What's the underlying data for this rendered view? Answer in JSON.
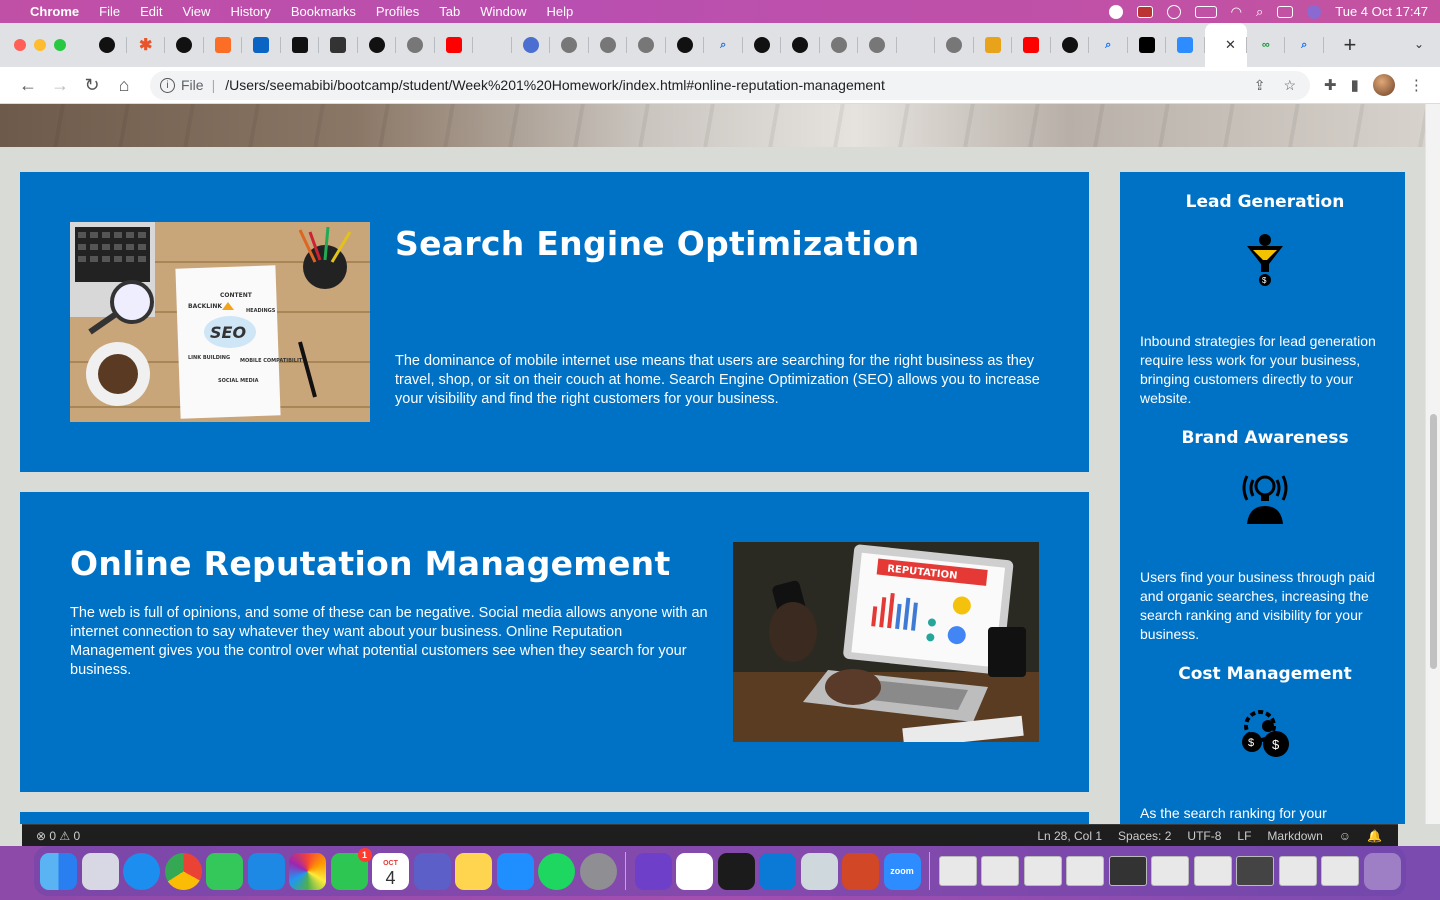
{
  "menubar": {
    "app": "Chrome",
    "items": [
      "File",
      "Edit",
      "View",
      "History",
      "Bookmarks",
      "Profiles",
      "Tab",
      "Window",
      "Help"
    ],
    "clock": "Tue 4 Oct  17:47"
  },
  "browser": {
    "active_tab_close": "✕",
    "new_tab": "+",
    "address_scheme": "File",
    "address_url": "/Users/seemabibi/bootcamp/student/Week%201%20Homework/index.html#online-reputation-management"
  },
  "seo": {
    "title": "Search Engine Optimization",
    "body": "The dominance of mobile internet use means that users are searching for the right business as they travel, shop, or sit on their couch at home. Search Engine Optimization (SEO) allows you to increase your visibility and find the right customers for your business.",
    "img_words": [
      "CONTENT",
      "BACKLINK",
      "HEADINGS",
      "SEO",
      "LINK BUILDING",
      "MOBILE COMPATIBILITY",
      "SOCIAL MEDIA"
    ]
  },
  "orm": {
    "title": "Online Reputation Management",
    "body": "The web is full of opinions, and some of these can be negative. Social media allows anyone with an internet connection to say whatever they want about your business. Online Reputation Management gives you the control over what potential customers see when they search for your business.",
    "img_word": "REPUTATION"
  },
  "aside": {
    "lead": {
      "title": "Lead Generation",
      "body": "Inbound strategies for lead generation require less work for your business, bringing customers directly to your website."
    },
    "brand": {
      "title": "Brand Awareness",
      "body": "Users find your business through paid and organic searches, increasing the search ranking and visibility for your business."
    },
    "cost": {
      "title": "Cost Management",
      "body": "As the search ranking for your"
    }
  },
  "statusbar": {
    "problems": "⊗ 0 ⚠ 0",
    "position": "Ln 28, Col 1",
    "spaces": "Spaces: 2",
    "encoding": "UTF-8",
    "eol": "LF",
    "language": "Markdown"
  },
  "dock": {
    "calendar_month": "OCT",
    "calendar_day": "4",
    "messages_badge": "1",
    "zoom_label": "zoom"
  }
}
